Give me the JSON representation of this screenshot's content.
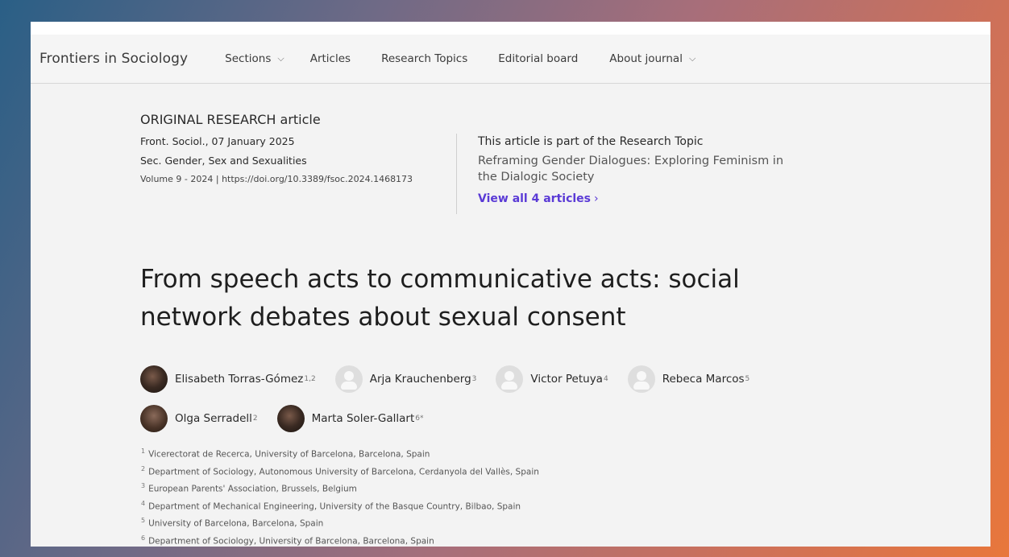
{
  "nav": {
    "brand": "Frontiers in Sociology",
    "items": [
      {
        "label": "Sections",
        "dropdown": true
      },
      {
        "label": "Articles",
        "dropdown": false
      },
      {
        "label": "Research Topics",
        "dropdown": false
      },
      {
        "label": "Editorial board",
        "dropdown": false
      },
      {
        "label": "About journal",
        "dropdown": true
      }
    ]
  },
  "article": {
    "type_label": "ORIGINAL RESEARCH article",
    "journal_date": "Front. Sociol., 07 January 2025",
    "section": "Sec. Gender, Sex and Sexualities",
    "volume_doi": "Volume 9 - 2024 | https://doi.org/10.3389/fsoc.2024.1468173",
    "title": "From speech acts to communicative acts: social network debates about sexual consent"
  },
  "research_topic": {
    "intro": "This article is part of the Research Topic",
    "title": "Reframing Gender Dialogues: Exploring Feminism in the Dialogic Society",
    "link": "View all 4 articles",
    "link_arrow": "›"
  },
  "authors": [
    {
      "name": "Elisabeth Torras-Gómez",
      "sup": "1,2",
      "avatar": "photo"
    },
    {
      "name": "Arja Krauchenberg",
      "sup": "3",
      "avatar": "placeholder"
    },
    {
      "name": "Victor Petuya",
      "sup": "4",
      "avatar": "placeholder"
    },
    {
      "name": "Rebeca Marcos",
      "sup": "5",
      "avatar": "placeholder"
    },
    {
      "name": "Olga Serradell",
      "sup": "2",
      "avatar": "photo"
    },
    {
      "name": "Marta Soler-Gallart",
      "sup": "6*",
      "avatar": "photo"
    }
  ],
  "affiliations": [
    {
      "num": "1",
      "text": "Vicerectorat de Recerca, University of Barcelona, Barcelona, Spain"
    },
    {
      "num": "2",
      "text": "Department of Sociology, Autonomous University of Barcelona, Cerdanyola del Vallès, Spain"
    },
    {
      "num": "3",
      "text": "European Parents' Association, Brussels, Belgium"
    },
    {
      "num": "4",
      "text": "Department of Mechanical Engineering, University of the Basque Country, Bilbao, Spain"
    },
    {
      "num": "5",
      "text": "University of Barcelona, Barcelona, Spain"
    },
    {
      "num": "6",
      "text": "Department of Sociology, University of Barcelona, Barcelona, Spain"
    }
  ],
  "icons": {
    "dropdown": "chevron-down-icon",
    "link_arrow": "chevron-right-icon"
  }
}
